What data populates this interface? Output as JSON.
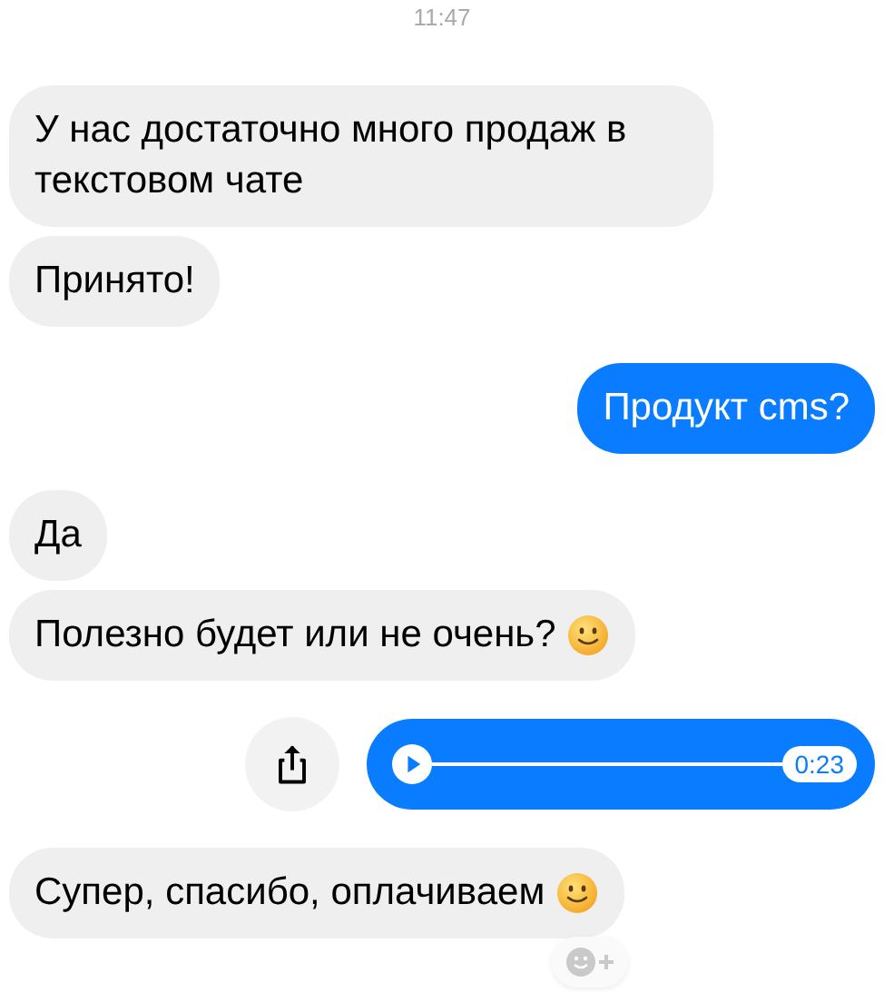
{
  "timestamp": "11:47",
  "messages": [
    {
      "kind": "text",
      "outgoing": false,
      "text": "У нас достаточно много продаж в текстовом чате",
      "emoji": false
    },
    {
      "kind": "text",
      "outgoing": false,
      "text": "Принято!",
      "emoji": false
    },
    {
      "kind": "text",
      "outgoing": true,
      "text": "Продукт cms?",
      "emoji": false
    },
    {
      "kind": "text",
      "outgoing": false,
      "text": "Да",
      "emoji": false
    },
    {
      "kind": "text",
      "outgoing": false,
      "text": "Полезно будет или не очень?",
      "emoji": true
    },
    {
      "kind": "voice",
      "outgoing": true,
      "duration": "0:23"
    },
    {
      "kind": "text",
      "outgoing": false,
      "text": "Супер, спасибо, оплачиваем",
      "emoji": true,
      "reaction_button": true
    }
  ]
}
